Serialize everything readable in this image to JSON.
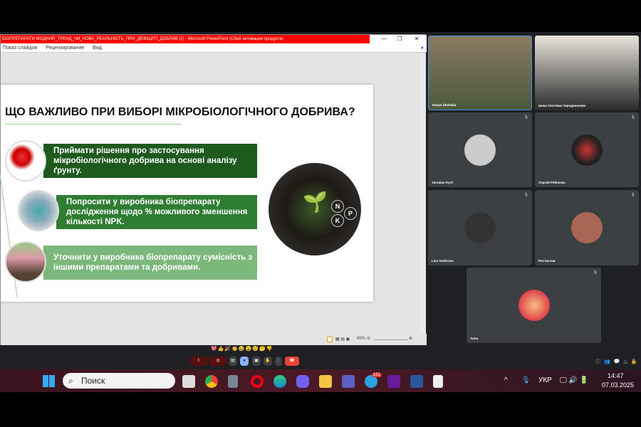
{
  "ppt": {
    "title": "БІОПРЕПАРАТИ МОДНИЙ_ТРЕНД_ЧИ_НОВА_РЕАЛЬНІСТЬ_ПРИ_ДЕФІЦИТІ_ДОБРИВ (2) - Microsoft PowerPoint (Сбой активации продукта)",
    "menu": [
      "Показ слайдов",
      "Рецензирование",
      "Вид"
    ],
    "zoom": "80%"
  },
  "slide": {
    "title": "ЩО ВАЖЛИВО ПРИ ВИБОРІ МІКРОБІОЛОГІЧНОГО ДОБРИВА?",
    "items": [
      "Приймати рішення про застосування мікробіологічного добрива на основі аналізу ґрунту.",
      "Попросити у виробника біопрепарату дослідження щодо % можливого зменшення кількості NPK.",
      "Уточнити у виробника біопрепарату сумісність з іншими препаратами та добривами."
    ],
    "npk": [
      "N",
      "P",
      "K"
    ],
    "colors": [
      "#1e5a1e",
      "#2e7d32",
      "#7cb87c"
    ]
  },
  "participants": [
    "Danya Shcheka",
    "Ірина Олегівна Чередниченко",
    "Yaroslav Kyril",
    "Сергей Рябченко",
    "Lisa Vasilcova",
    "Ростислав",
    "Анна"
  ],
  "reactions": "💖👍🎉👏😂😮😢🤔👎",
  "taskbar": {
    "search": "Поиск",
    "lang": "УКР",
    "time": "14:47",
    "date": "07.03.2025",
    "telegram_badge": "151"
  }
}
